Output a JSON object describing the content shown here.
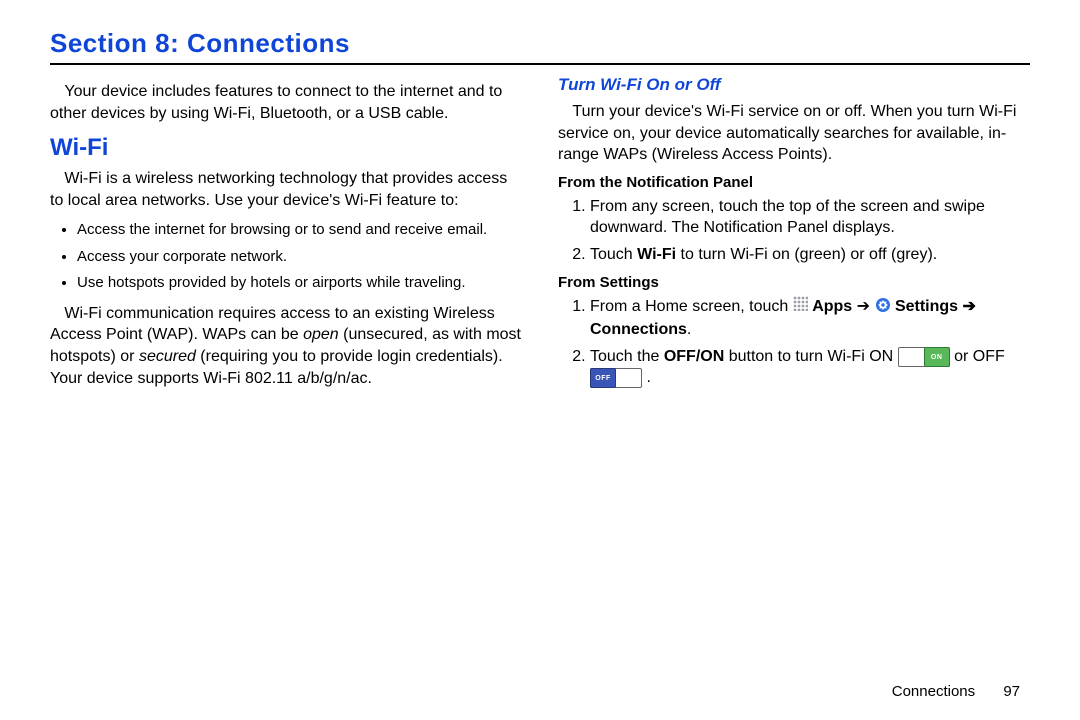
{
  "header": {
    "section_title": "Section 8: Connections"
  },
  "left": {
    "intro": "Your device includes features to connect to the internet and to other devices by using Wi-Fi, Bluetooth, or a USB cable.",
    "h2": "Wi-Fi",
    "p1": "Wi-Fi is a wireless networking technology that provides access to local area networks. Use your device's Wi-Fi feature to:",
    "bullets": [
      "Access the internet for browsing or to send and receive email.",
      "Access your corporate network.",
      "Use hotspots provided by hotels or airports while traveling."
    ],
    "p2_a": "Wi-Fi communication requires access to an existing Wireless Access Point (WAP). WAPs can be ",
    "p2_open": "open",
    "p2_b": " (unsecured, as with most hotspots) or ",
    "p2_secured": "secured",
    "p2_c": " (requiring you to provide login credentials). Your device supports Wi-Fi 802.11 a/b/g/n/ac."
  },
  "right": {
    "h3": "Turn Wi-Fi On or Off",
    "p1": "Turn your device's Wi-Fi service on or off. When you turn Wi-Fi service on, your device automatically searches for available, in-range WAPs (Wireless Access Points).",
    "sub1": "From the Notification Panel",
    "steps1": {
      "s1": "From any screen, touch the top of the screen and swipe downward. The Notification Panel displays.",
      "s2_a": "Touch ",
      "s2_wifi": "Wi-Fi",
      "s2_b": " to turn Wi-Fi on (green) or off (grey)."
    },
    "sub2": "From Settings",
    "steps2": {
      "s1_a": "From a Home screen, touch ",
      "s1_apps": " Apps",
      "s1_arrow1": " ➔ ",
      "s1_settings": " Settings",
      "s1_arrow2": " ➔ ",
      "s1_connections": "Connections",
      "s1_dot": ".",
      "s2_a": "Touch the ",
      "s2_offon": "OFF/ON",
      "s2_b": " button to turn Wi-Fi ON ",
      "s2_c": " or OFF ",
      "s2_d": "."
    }
  },
  "footer": {
    "label": "Connections",
    "page": "97"
  }
}
